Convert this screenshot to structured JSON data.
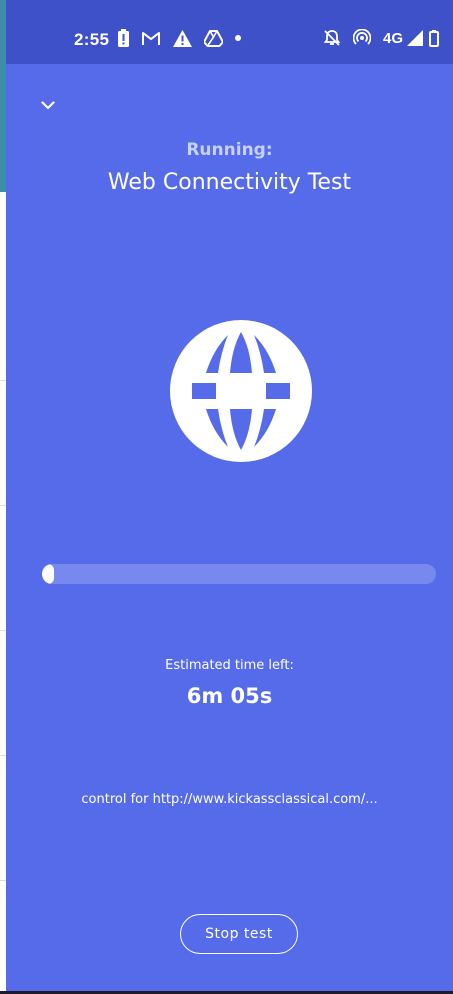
{
  "status_bar": {
    "time": "2:55",
    "network": "4G",
    "icons_left": [
      "battery-alert-icon",
      "gmail-icon",
      "warning-icon",
      "drive-icon",
      "more-dot-icon"
    ],
    "icons_right": [
      "alarm-off-icon",
      "hotspot-icon",
      "4g-label",
      "signal-icon",
      "battery-icon"
    ]
  },
  "header": {
    "collapse_icon": "chevron-down-icon",
    "running_label": "Running:",
    "test_name": "Web Connectivity Test"
  },
  "illustration": {
    "icon": "globe-icon"
  },
  "progress": {
    "fraction": 0.0
  },
  "eta": {
    "label": "Estimated time left:",
    "value": "6m 05s"
  },
  "log": {
    "current": "control for http://www.kickassclassical.com/..."
  },
  "actions": {
    "stop_label": "Stop test"
  },
  "colors": {
    "status_bar": "#3f51c9",
    "panel": "#566bea",
    "text": "#ffffff",
    "running_label": "#c7d0f8"
  }
}
